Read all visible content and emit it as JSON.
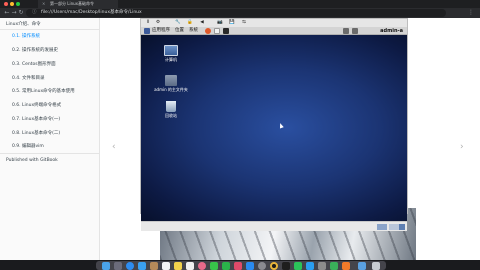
{
  "browser": {
    "tab_title": "第一部分 Linux基础命令",
    "url": "file:///Users/mac/Desktop/linux基本命令/Linux",
    "colors": {
      "close": "#ff5f57",
      "minimize": "#febc2e",
      "maximize": "#28c840"
    }
  },
  "sidebar": {
    "title": "Linux介绍、命令",
    "items": [
      {
        "label": "0.1. 操作系统",
        "active": true
      },
      {
        "label": "0.2. 操作系统的发展史",
        "active": false
      },
      {
        "label": "0.3. Centos图形界面",
        "active": false
      },
      {
        "label": "0.4. 文件和目录",
        "active": false
      },
      {
        "label": "0.5. 常用Linux命令的基本使用",
        "active": false
      },
      {
        "label": "0.6. Linux终端命令格式",
        "active": false
      },
      {
        "label": "0.7. Linux基本命令(一)",
        "active": false
      },
      {
        "label": "0.8. Linux基本命令(二)",
        "active": false
      },
      {
        "label": "0.9. 编辑器vim",
        "active": false
      }
    ],
    "published": "Published with GitBook"
  },
  "vm": {
    "panel": {
      "menu_apps": "应用程序",
      "menu_places": "位置",
      "menu_system": "系统",
      "user": "admin-a"
    },
    "desktop_icons": [
      {
        "label": "计算机",
        "icon": "computer-icon"
      },
      {
        "label": "admin 的主文件夹",
        "icon": "home-folder-icon"
      },
      {
        "label": "回收站",
        "icon": "trash-icon"
      }
    ]
  },
  "nav": {
    "prev": "‹",
    "next": "›"
  }
}
